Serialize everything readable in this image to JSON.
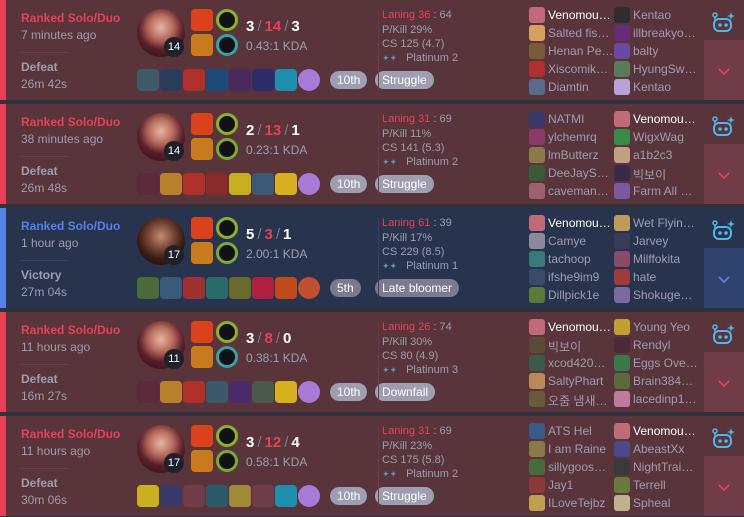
{
  "colors": {
    "defeat_accent": "#e84057",
    "victory_accent": "#5383e8",
    "defeat_bg": "#59343b",
    "victory_bg": "#28344e"
  },
  "matches": [
    {
      "result_class": "loss",
      "queue": "Ranked Solo/Duo",
      "time_ago": "7 minutes ago",
      "result": "Defeat",
      "duration": "26m 42s",
      "champion": "fiora-portrait",
      "level": "14",
      "kills": "3",
      "deaths": "14",
      "assists": "3",
      "kda_ratio": "0.43:1 KDA",
      "spells": [
        "#d9421a",
        "#c97a1c"
      ],
      "runes": [
        "#8db02a",
        "#3aa0a8"
      ],
      "items": [
        "#3c5a6a",
        "#2a3c5c",
        "#b0302a",
        "#1e4a7a",
        "#4a2a5e",
        "#2c2c6a",
        "#1f8fae"
      ],
      "ward_color": "#a77ad8",
      "badges": [
        "10th",
        "Struggle"
      ],
      "laning_score": "Laning 36",
      "laning_opp": " : 64",
      "pkill": "P/Kill 29%",
      "cs": "CS 125 (4.7)",
      "rank": "Platinum 2",
      "wings": "✦✦",
      "team1": [
        {
          "n": "Venomou…",
          "c": "#c06a7a",
          "me": true
        },
        {
          "n": "Salted fis…",
          "c": "#d8a060"
        },
        {
          "n": "Henan Pe…",
          "c": "#7a5a3a"
        },
        {
          "n": "Xiscomik…",
          "c": "#b03030"
        },
        {
          "n": "Diamtin",
          "c": "#5a6a8a"
        }
      ],
      "team2": [
        {
          "n": "Kentao",
          "c": "#2e2e2e"
        },
        {
          "n": "illbreakyo…",
          "c": "#6a2a7a"
        },
        {
          "n": "balty",
          "c": "#6a4aa0"
        },
        {
          "n": "HyungSw…",
          "c": "#5a7a5a"
        },
        {
          "n": "Kentao",
          "c": "#b8a0d8"
        }
      ]
    },
    {
      "result_class": "loss",
      "queue": "Ranked Solo/Duo",
      "time_ago": "38 minutes ago",
      "result": "Defeat",
      "duration": "26m 48s",
      "champion": "fiora-portrait",
      "level": "14",
      "kills": "2",
      "deaths": "13",
      "assists": "1",
      "kda_ratio": "0.23:1 KDA",
      "spells": [
        "#d9421a",
        "#c97a1c"
      ],
      "runes": [
        "#8db02a",
        "#7aa838"
      ],
      "items": [
        "#5a2a3a",
        "#b8802a",
        "#b0302a",
        "#8a2a2a",
        "#c8b020",
        "#3a5a7a",
        "#d8b020"
      ],
      "ward_color": "#a77ad8",
      "badges": [
        "10th",
        "Struggle"
      ],
      "laning_score": "Laning 31",
      "laning_opp": " : 69",
      "pkill": "P/Kill 11%",
      "cs": "CS 141 (5.3)",
      "rank": "Platinum 2",
      "wings": "✦✦",
      "team1": [
        {
          "n": "NATMI",
          "c": "#3a3a6a"
        },
        {
          "n": "ylchemrq",
          "c": "#8a3a6a"
        },
        {
          "n": "lmButterz",
          "c": "#8a7a4a"
        },
        {
          "n": "DeeJayS…",
          "c": "#3a5a3a"
        },
        {
          "n": "caveman…",
          "c": "#a0606a"
        }
      ],
      "team2": [
        {
          "n": "Venomou…",
          "c": "#c06a7a",
          "me": true
        },
        {
          "n": "WigxWag",
          "c": "#3a8a4a"
        },
        {
          "n": "a1b2c3",
          "c": "#c0a080"
        },
        {
          "n": "빅보이",
          "c": "#3a2a4a"
        },
        {
          "n": "Farm All …",
          "c": "#7a5aa0"
        }
      ]
    },
    {
      "result_class": "win",
      "queue": "Ranked Solo/Duo",
      "time_ago": "1 hour ago",
      "result": "Victory",
      "duration": "27m 04s",
      "champion": "darius-portrait",
      "level": "17",
      "kills": "5",
      "deaths": "3",
      "assists": "1",
      "kda_ratio": "2.00:1 KDA",
      "spells": [
        "#d9421a",
        "#c97a1c"
      ],
      "runes": [
        "#8db02a",
        "#7aa838"
      ],
      "items": [
        "#4a6a3a",
        "#3a5a7a",
        "#a03030",
        "#2a6a6a",
        "#6a6a2a",
        "#b02040",
        "#c04a1a"
      ],
      "ward_color": "#c05030",
      "badges": [
        "5th",
        "Late bloomer"
      ],
      "laning_score": "Laning 61",
      "laning_opp": " : 39",
      "pkill": "P/Kill 17%",
      "cs": "CS 229 (8.5)",
      "rank": "Platinum 1",
      "wings": "✦✦",
      "team1": [
        {
          "n": "Venomou…",
          "c": "#c06a7a",
          "me": true
        },
        {
          "n": "Camye",
          "c": "#8a8a9a"
        },
        {
          "n": "tachoop",
          "c": "#3a7a7a"
        },
        {
          "n": "ifshe9im9",
          "c": "#3a4a6a"
        },
        {
          "n": "Dillpick1e",
          "c": "#5a7a3a"
        }
      ],
      "team2": [
        {
          "n": "Wet Flyin…",
          "c": "#c09a5a"
        },
        {
          "n": "Jarvey",
          "c": "#3a3a5a"
        },
        {
          "n": "Milffokita",
          "c": "#8a4a6a"
        },
        {
          "n": "hate",
          "c": "#a03a3a"
        },
        {
          "n": "Shokuge…",
          "c": "#7a6aa0"
        }
      ]
    },
    {
      "result_class": "loss",
      "queue": "Ranked Solo/Duo",
      "time_ago": "11 hours ago",
      "result": "Defeat",
      "duration": "16m 27s",
      "champion": "fiora-portrait",
      "level": "11",
      "kills": "3",
      "deaths": "8",
      "assists": "0",
      "kda_ratio": "0.38:1 KDA",
      "spells": [
        "#d9421a",
        "#c97a1c"
      ],
      "runes": [
        "#8db02a",
        "#3aa0a8"
      ],
      "items": [
        "#5a2a3a",
        "#b8802a",
        "#b0302a",
        "#3a5a6a",
        "#4a2a6a",
        "#4a5a4a",
        "#d8b020"
      ],
      "ward_color": "#a77ad8",
      "badges": [
        "10th",
        "Downfall"
      ],
      "laning_score": "Laning 26",
      "laning_opp": " : 74",
      "pkill": "P/Kill 30%",
      "cs": "CS 80 (4.9)",
      "rank": "Platinum 3",
      "wings": "✦✦",
      "team1": [
        {
          "n": "Venomou…",
          "c": "#c06a7a",
          "me": true
        },
        {
          "n": "빅보이",
          "c": "#5a4a3a"
        },
        {
          "n": "xcod420…",
          "c": "#3a5a4a"
        },
        {
          "n": "SaltyPhart",
          "c": "#b88a5a"
        },
        {
          "n": "오줌 냄새…",
          "c": "#6a5a3a"
        }
      ],
      "team2": [
        {
          "n": "Young Yeo",
          "c": "#c0a030"
        },
        {
          "n": "Rendyl",
          "c": "#4a2a3a"
        },
        {
          "n": "Eggs Ove…",
          "c": "#3a7a4a"
        },
        {
          "n": "Brain384…",
          "c": "#5a6a3a"
        },
        {
          "n": "lacedinp1…",
          "c": "#c07aa0"
        }
      ]
    },
    {
      "result_class": "loss",
      "queue": "Ranked Solo/Duo",
      "time_ago": "11 hours ago",
      "result": "Defeat",
      "duration": "30m 06s",
      "champion": "fiora-portrait",
      "level": "17",
      "kills": "3",
      "deaths": "12",
      "assists": "4",
      "kda_ratio": "0.58:1 KDA",
      "spells": [
        "#d9421a",
        "#c97a1c"
      ],
      "runes": [
        "#8db02a",
        "#7aa838"
      ],
      "items": [
        "#c8b020",
        "#3a3a6a",
        "",
        "#2a5a6a",
        "#a08a3a",
        "",
        "#1f8fae"
      ],
      "ward_color": "#a77ad8",
      "badges": [
        "10th",
        "Struggle"
      ],
      "laning_score": "Laning 31",
      "laning_opp": " : 69",
      "pkill": "P/Kill 23%",
      "cs": "CS 175 (5.8)",
      "rank": "Platinum 2",
      "wings": "✦✦",
      "team1": [
        {
          "n": "ATS Hel",
          "c": "#3a5a8a"
        },
        {
          "n": "I am Raine",
          "c": "#8a7a4a"
        },
        {
          "n": "sillygoos…",
          "c": "#4a6a3a"
        },
        {
          "n": "Jay1",
          "c": "#8a3a3a"
        },
        {
          "n": "ILoveTejbz",
          "c": "#c0a050"
        }
      ],
      "team2": [
        {
          "n": "Venomou…",
          "c": "#c06a7a",
          "me": true
        },
        {
          "n": "AbeastXx",
          "c": "#4a4a8a"
        },
        {
          "n": "NightTrai…",
          "c": "#3a3a3a"
        },
        {
          "n": "Terrell",
          "c": "#6a7a3a"
        },
        {
          "n": "Spheal",
          "c": "#c0b090"
        }
      ]
    }
  ]
}
